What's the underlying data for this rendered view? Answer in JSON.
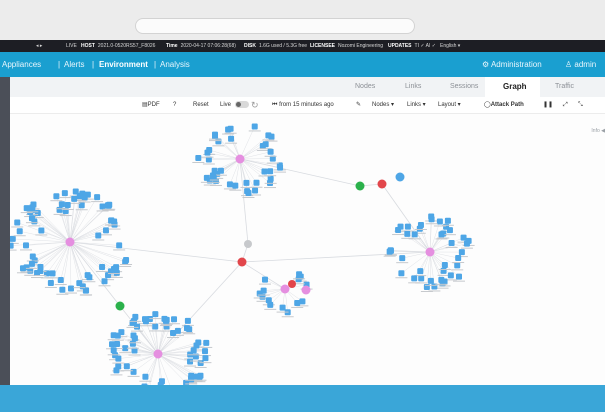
{
  "infobar": {
    "live": "LIVE",
    "host_label": "HOST",
    "host_value": "2021.0-0520RS57_F8026",
    "time_label": "Time",
    "time_value": "2020-04-17 07:06:28(68)",
    "disk_label": "DISK",
    "disk_value": "1.6G used / 5.3G free",
    "licensee_label": "LICENSEE",
    "licensee_value": "Nozomi Engineering",
    "updates_label": "UPDATES",
    "updates_value": "TI ✓ AI ✓",
    "language": "English ▾"
  },
  "nav": {
    "appliances": "Appliances",
    "alerts": "Alerts",
    "environment": "Environment",
    "analysis": "Analysis",
    "administration": "Administration",
    "user": "admin"
  },
  "tabs": [
    "Nodes",
    "Links",
    "Sessions",
    "Graph",
    "Traffic"
  ],
  "toolbar": {
    "pdf": "PDF",
    "help": "?",
    "reset": "Reset",
    "live": "Live",
    "time_range": "from 15 minutes ago",
    "nodes": "Nodes ▾",
    "links": "Links ▾",
    "layout": "Layout ▾",
    "attack_path": "Attack Path",
    "pause": "❚❚",
    "expand": "⤢",
    "collapse": "⤡"
  },
  "graph": {
    "info_label": "Info ◀",
    "colors": {
      "cluster_node": "#4ea6e6",
      "hub": "#e58fe0",
      "router_red": "#e2464b",
      "switch_green": "#2bb14b",
      "gray": "#c7c9cc",
      "edge": "#d8dbe0"
    }
  }
}
